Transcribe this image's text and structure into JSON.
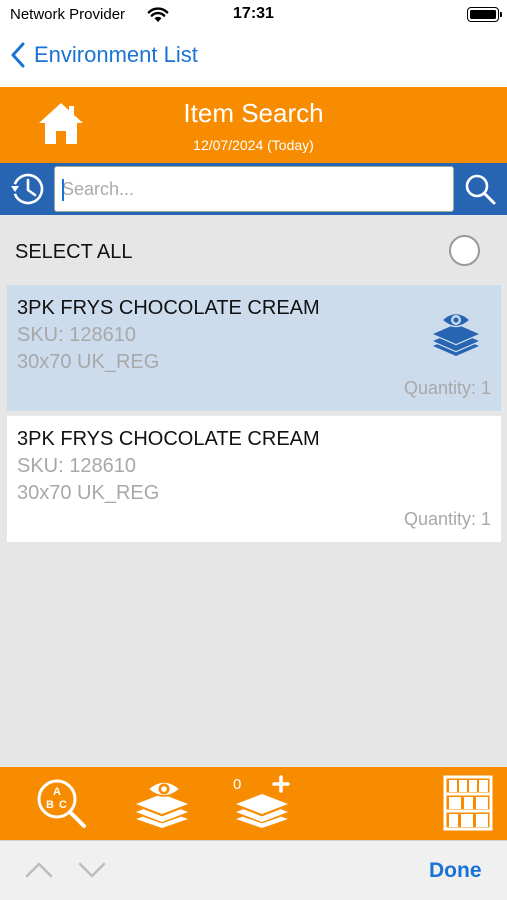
{
  "status_bar": {
    "carrier": "Network Provider",
    "time": "17:31"
  },
  "nav": {
    "back_label": "Environment List"
  },
  "header": {
    "title": "Item Search",
    "date": "12/07/2024 (Today)"
  },
  "search": {
    "placeholder": "Search...",
    "value": ""
  },
  "select_all": {
    "label": "SELECT ALL"
  },
  "items": [
    {
      "name": "3PK FRYS CHOCOLATE CREAM",
      "sku": "SKU: 128610",
      "size": "30x70 UK_REG",
      "quantity": "Quantity: 1",
      "selected": true
    },
    {
      "name": "3PK FRYS CHOCOLATE CREAM",
      "sku": "SKU: 128610",
      "size": "30x70 UK_REG",
      "quantity": "Quantity: 1",
      "selected": false
    }
  ],
  "toolbar": {
    "add_count": "0",
    "icons": [
      "abc-search-icon",
      "layers-view-icon",
      "layers-add-icon",
      "shelf-icon"
    ]
  },
  "accessory": {
    "done_label": "Done"
  },
  "colors": {
    "accent_orange": "#f88c00",
    "search_blue": "#2765b3",
    "link_blue": "#1a73d4",
    "selected_row": "#ccdced"
  }
}
